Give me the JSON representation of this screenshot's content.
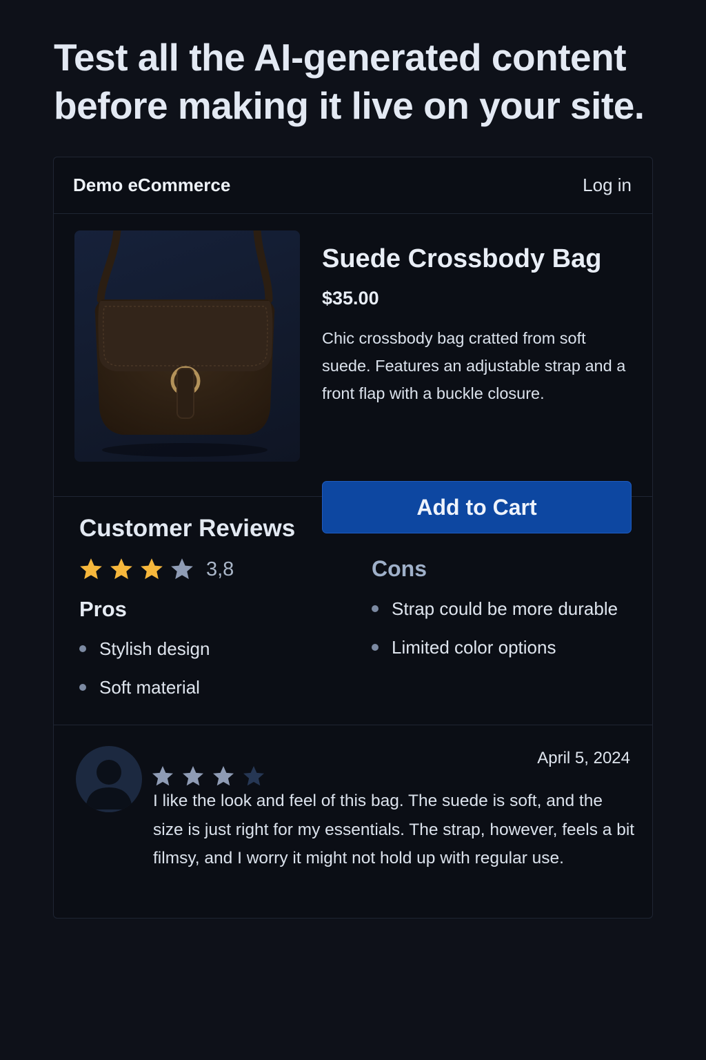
{
  "headline": "Test all the AI-generated content before making it live on your site.",
  "nav": {
    "brand": "Demo eCommerce",
    "login_label": "Log in"
  },
  "product": {
    "title": "Suede Crossbody Bag",
    "price": "$35.00",
    "description": "Chic crossbody bag cratted from soft suede. Features an adjustable strap and a front flap with a buckle closure.",
    "add_to_cart_label": "Add to Cart",
    "image_icon": "crossbody-bag-photo"
  },
  "reviews_summary": {
    "title": "Customer Reviews",
    "rating": "3,8",
    "stars_filled": 3,
    "stars_total": 4,
    "pros_title": "Pros",
    "pros": [
      "Stylish design",
      "Soft material"
    ],
    "cons_title": "Cons",
    "cons": [
      "Strap could be more durable",
      "Limited color options"
    ]
  },
  "review": {
    "stars_filled": 3,
    "stars_total": 4,
    "date": "April 5, 2024",
    "text": "I like the look and feel of this bag. The suede is soft, and the size is just right for my essentials. The strap, however, feels a bit filmsy, and I worry it might not hold up with regular use.",
    "avatar_icon": "user-avatar-icon"
  },
  "colors": {
    "background": "#0e1119",
    "card": "#0b0e15",
    "accent_button": "#0d47a1",
    "star_gold": "#f6b73c",
    "star_muted": "#8f9cb5",
    "star_dim": "#263754"
  }
}
